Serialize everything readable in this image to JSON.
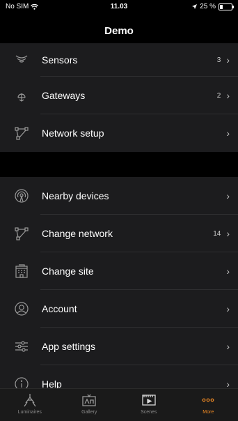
{
  "status": {
    "carrier": "No SIM",
    "time": "11.03",
    "battery": "25 %"
  },
  "header": {
    "title": "Demo"
  },
  "list_items": [
    {
      "label": "Sensors",
      "count": "3",
      "icon": "sensors-icon"
    },
    {
      "label": "Gateways",
      "count": "2",
      "icon": "gateway-icon"
    },
    {
      "label": "Network setup",
      "count": "",
      "icon": "network-icon"
    }
  ],
  "list_items_2": [
    {
      "label": "Nearby devices",
      "count": "",
      "icon": "nearby-icon"
    },
    {
      "label": "Change network",
      "count": "14",
      "icon": "network-icon"
    },
    {
      "label": "Change site",
      "count": "",
      "icon": "building-icon"
    },
    {
      "label": "Account",
      "count": "",
      "icon": "account-icon"
    },
    {
      "label": "App settings",
      "count": "",
      "icon": "sliders-icon"
    },
    {
      "label": "Help",
      "count": "",
      "icon": "info-icon"
    }
  ],
  "tabs": [
    {
      "label": "Luminaires",
      "icon": "luminaire-icon"
    },
    {
      "label": "Gallery",
      "icon": "gallery-icon"
    },
    {
      "label": "Scenes",
      "icon": "scenes-icon"
    },
    {
      "label": "More",
      "icon": "more-icon"
    }
  ],
  "colors": {
    "accent": "#f08a24",
    "background": "#000000",
    "row_background": "#1c1c1e"
  }
}
